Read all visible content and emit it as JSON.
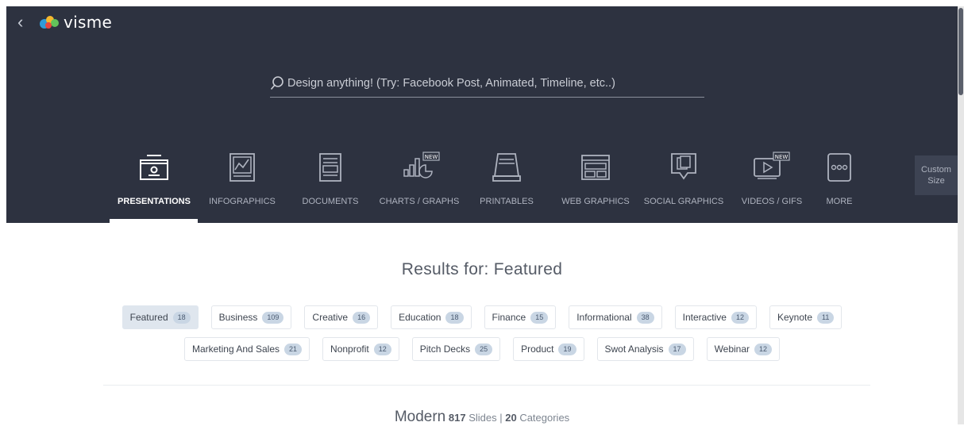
{
  "app": {
    "name": "visme"
  },
  "search": {
    "placeholder": "Design anything! (Try: Facebook Post, Animated, Timeline, etc..)"
  },
  "categories": [
    {
      "label": "PRESENTATIONS",
      "icon": "presentation-icon",
      "active": true
    },
    {
      "label": "INFOGRAPHICS",
      "icon": "infographic-icon"
    },
    {
      "label": "DOCUMENTS",
      "icon": "document-icon"
    },
    {
      "label": "CHARTS / GRAPHS",
      "icon": "chart-icon",
      "badge": "NEW"
    },
    {
      "label": "PRINTABLES",
      "icon": "printable-icon"
    },
    {
      "label": "WEB GRAPHICS",
      "icon": "web-graphics-icon"
    },
    {
      "label": "SOCIAL GRAPHICS",
      "icon": "social-graphics-icon"
    },
    {
      "label": "VIDEOS / GIFS",
      "icon": "video-icon",
      "badge": "NEW"
    },
    {
      "label": "MORE",
      "icon": "more-icon"
    }
  ],
  "custom_size": {
    "line1": "Custom",
    "line2": "Size"
  },
  "results": {
    "title": "Results for: Featured"
  },
  "tags_row1": [
    {
      "label": "Featured",
      "count": "18",
      "selected": true
    },
    {
      "label": "Business",
      "count": "109"
    },
    {
      "label": "Creative",
      "count": "16"
    },
    {
      "label": "Education",
      "count": "18"
    },
    {
      "label": "Finance",
      "count": "15"
    },
    {
      "label": "Informational",
      "count": "38"
    },
    {
      "label": "Interactive",
      "count": "12"
    },
    {
      "label": "Keynote",
      "count": "11"
    }
  ],
  "tags_row2": [
    {
      "label": "Marketing And Sales",
      "count": "21"
    },
    {
      "label": "Nonprofit",
      "count": "12"
    },
    {
      "label": "Pitch Decks",
      "count": "25"
    },
    {
      "label": "Product",
      "count": "19"
    },
    {
      "label": "Swot Analysis",
      "count": "17"
    },
    {
      "label": "Webinar",
      "count": "12"
    }
  ],
  "section": {
    "name": "Modern",
    "slides_count": "817",
    "slides_label": "Slides |",
    "categories_count": "20",
    "categories_label": "Categories"
  },
  "colors": {
    "header_bg": "#2d3240",
    "badge_bg": "#c9d6e4",
    "selected_tag_bg": "#dfe6ee"
  }
}
